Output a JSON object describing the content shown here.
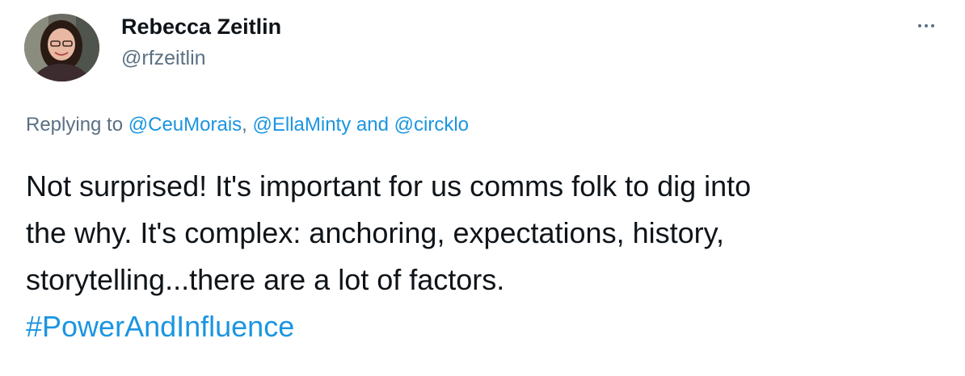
{
  "author": {
    "display_name": "Rebecca Zeitlin",
    "handle": "@rfzeitlin"
  },
  "reply": {
    "prefix": "Replying to ",
    "mentions": [
      "@CeuMorais",
      "@EllaMinty",
      "@circklo"
    ],
    "sep1": ", ",
    "sep2": " and "
  },
  "tweet": {
    "lines": [
      "Not surprised! It's important for us comms folk to dig into",
      "the why. It's complex: anchoring, expectations, history,",
      "storytelling...there are a lot of factors."
    ],
    "hashtag": "#PowerAndInfluence"
  },
  "colors": {
    "link": "#1b95e0",
    "muted": "#5b7083",
    "text": "#0f1419"
  },
  "icons": {
    "more": "more-horizontal-icon"
  }
}
